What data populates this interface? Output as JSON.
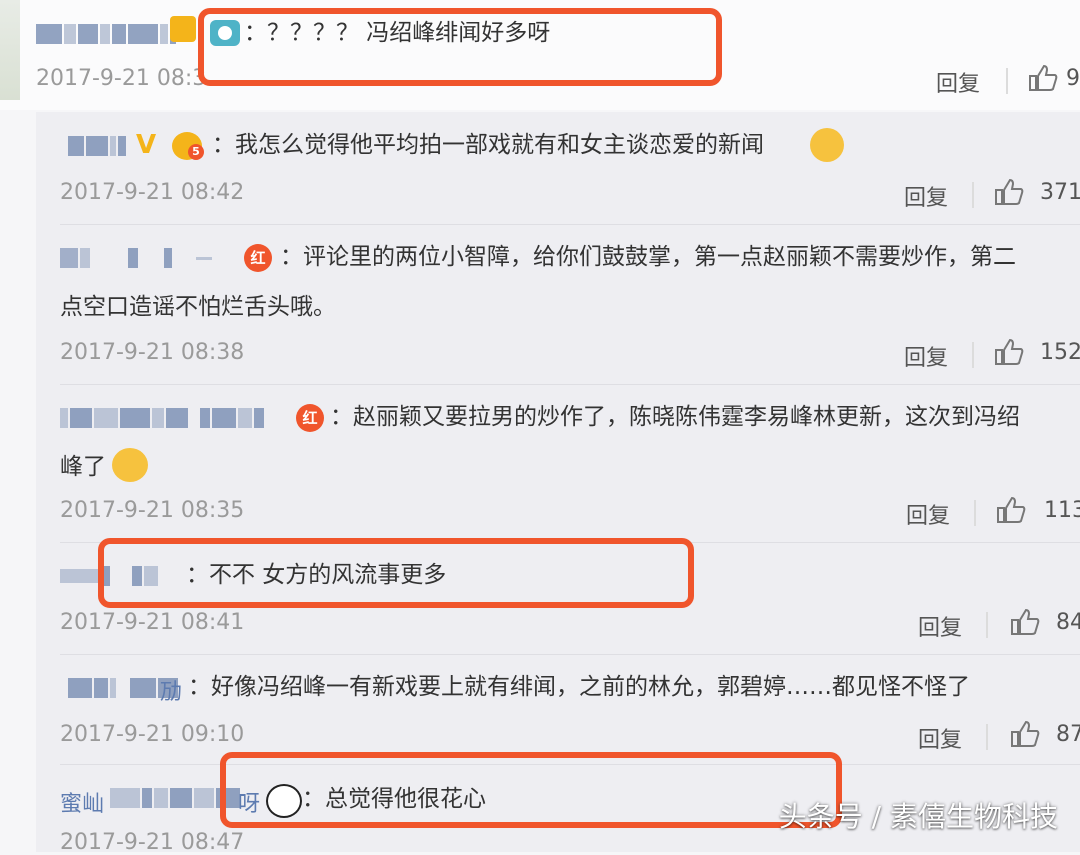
{
  "top_comment": {
    "text": "：？？？？ 冯绍峰绯闻好多呀",
    "time": "2017-9-21 08:3",
    "reply_label": "回复",
    "likes": "9"
  },
  "replies": [
    {
      "text": "：我怎么觉得他平均拍一部戏就有和女主谈恋爱的新闻",
      "time": "2017-9-21 08:42",
      "reply_label": "回复",
      "likes": "371"
    },
    {
      "text_line1": "：评论里的两位小智障，给你们鼓鼓掌，第一点赵丽颖不需要炒作，第二",
      "text_line2": "点空口造谣不怕烂舌头哦。",
      "time": "2017-9-21 08:38",
      "reply_label": "回复",
      "likes": "152"
    },
    {
      "text_line1": "：赵丽颖又要拉男的炒作了，陈晓陈伟霆李易峰林更新，这次到冯绍",
      "text_line2": "峰了",
      "time": "2017-9-21 08:35",
      "reply_label": "回复",
      "likes": "113"
    },
    {
      "text": "：不不  女方的风流事更多",
      "time": "2017-9-21 08:41",
      "reply_label": "回复",
      "likes": "84"
    },
    {
      "user_suffix": "劢",
      "text": "：好像冯绍峰一有新戏要上就有绯闻，之前的林允，郭碧婷……都见怪不怪了",
      "time": "2017-9-21 09:10",
      "reply_label": "回复",
      "likes": "87"
    },
    {
      "user_prefix": "蜜屾",
      "user_suffix": "呀",
      "text": "：总觉得他很花心",
      "time": "2017-9-21 08:47",
      "reply_label": "回复",
      "likes": "6"
    }
  ],
  "badges": {
    "red_label": "红",
    "level_label": "5"
  },
  "watermark": "头条号 / 素僖生物科技",
  "colors": {
    "highlight": "#f0552c",
    "username": "#5d7bb0",
    "time": "#9a9a9a"
  }
}
